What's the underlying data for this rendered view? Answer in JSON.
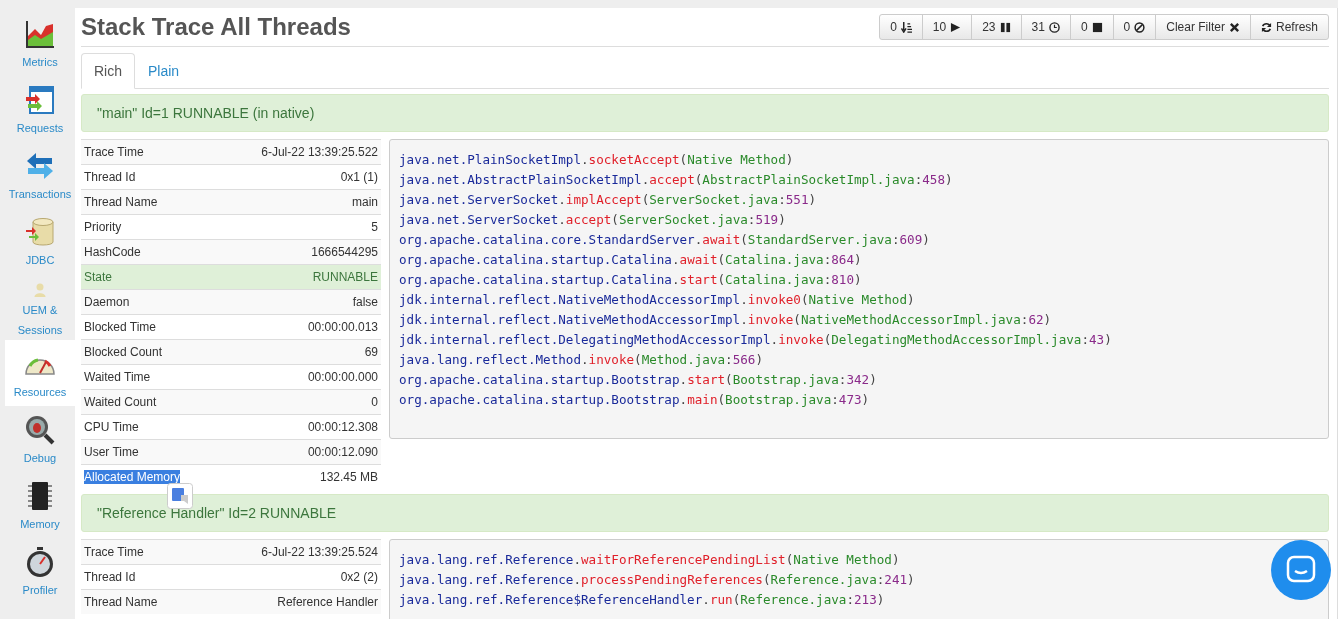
{
  "sidebar": {
    "items": [
      {
        "label": "Metrics",
        "selected": false
      },
      {
        "label": "Requests",
        "selected": false
      },
      {
        "label": "Transactions",
        "selected": false
      },
      {
        "label": "JDBC",
        "selected": false
      },
      {
        "label": "UEM & Sessions",
        "selected": false
      },
      {
        "label": "Resources",
        "selected": true
      },
      {
        "label": "Debug",
        "selected": false
      },
      {
        "label": "Memory",
        "selected": false
      },
      {
        "label": "Profiler",
        "selected": false
      }
    ]
  },
  "title": "Stack Trace All Threads",
  "toolbar": [
    {
      "label": "0",
      "kind": "sort"
    },
    {
      "label": "10",
      "kind": "play"
    },
    {
      "label": "23",
      "kind": "pause"
    },
    {
      "label": "31",
      "kind": "clock"
    },
    {
      "label": "0",
      "kind": "stop"
    },
    {
      "label": "0",
      "kind": "ban"
    },
    {
      "label": "Clear Filter",
      "kind": "clear"
    },
    {
      "label": "Refresh",
      "kind": "refresh"
    }
  ],
  "tabs": [
    {
      "label": "Rich",
      "selected": true
    },
    {
      "label": "Plain",
      "selected": false
    }
  ],
  "threads": [
    {
      "header": "\"main\" Id=1 RUNNABLE (in native)",
      "properties": [
        {
          "label": "Trace Time",
          "value": "6-Jul-22 13:39:25.522",
          "highlight": false
        },
        {
          "label": "Thread Id",
          "value": "0x1 (1)",
          "highlight": false
        },
        {
          "label": "Thread Name",
          "value": "main",
          "highlight": false
        },
        {
          "label": "Priority",
          "value": "5",
          "highlight": false
        },
        {
          "label": "HashCode",
          "value": "1666544295",
          "highlight": false
        },
        {
          "label": "State",
          "value": "RUNNABLE",
          "highlight": true
        },
        {
          "label": "Daemon",
          "value": "false",
          "highlight": false
        },
        {
          "label": "Blocked Time",
          "value": "00:00:00.013",
          "highlight": false
        },
        {
          "label": "Blocked Count",
          "value": "69",
          "highlight": false
        },
        {
          "label": "Waited Time",
          "value": "00:00:00.000",
          "highlight": false
        },
        {
          "label": "Waited Count",
          "value": "0",
          "highlight": false
        },
        {
          "label": "CPU Time",
          "value": "00:00:12.308",
          "highlight": false
        },
        {
          "label": "User Time",
          "value": "00:00:12.090",
          "highlight": false
        },
        {
          "label": "Allocated Memory",
          "value": "132.45 MB",
          "highlight": false,
          "text_selected": true
        }
      ],
      "frames": [
        "java.net.PlainSocketImpl.socketAccept(Native Method)",
        "java.net.AbstractPlainSocketImpl.accept(AbstractPlainSocketImpl.java:458)",
        "java.net.ServerSocket.implAccept(ServerSocket.java:551)",
        "java.net.ServerSocket.accept(ServerSocket.java:519)",
        "org.apache.catalina.core.StandardServer.await(StandardServer.java:609)",
        "org.apache.catalina.startup.Catalina.await(Catalina.java:864)",
        "org.apache.catalina.startup.Catalina.start(Catalina.java:810)",
        "jdk.internal.reflect.NativeMethodAccessorImpl.invoke0(Native Method)",
        "jdk.internal.reflect.NativeMethodAccessorImpl.invoke(NativeMethodAccessorImpl.java:62)",
        "jdk.internal.reflect.DelegatingMethodAccessorImpl.invoke(DelegatingMethodAccessorImpl.java:43)",
        "java.lang.reflect.Method.invoke(Method.java:566)",
        "org.apache.catalina.startup.Bootstrap.start(Bootstrap.java:342)",
        "org.apache.catalina.startup.Bootstrap.main(Bootstrap.java:473)"
      ]
    },
    {
      "header": "\"Reference Handler\" Id=2 RUNNABLE",
      "properties": [
        {
          "label": "Trace Time",
          "value": "6-Jul-22 13:39:25.524",
          "highlight": false
        },
        {
          "label": "Thread Id",
          "value": "0x2 (2)",
          "highlight": false
        },
        {
          "label": "Thread Name",
          "value": "Reference Handler",
          "highlight": false
        }
      ],
      "frames": [
        "java.lang.ref.Reference.waitForReferencePendingList(Native Method)",
        "java.lang.ref.Reference.processPendingReferences(Reference.java:241)",
        "java.lang.ref.Reference$ReferenceHandler.run(Reference.java:213)"
      ]
    }
  ]
}
